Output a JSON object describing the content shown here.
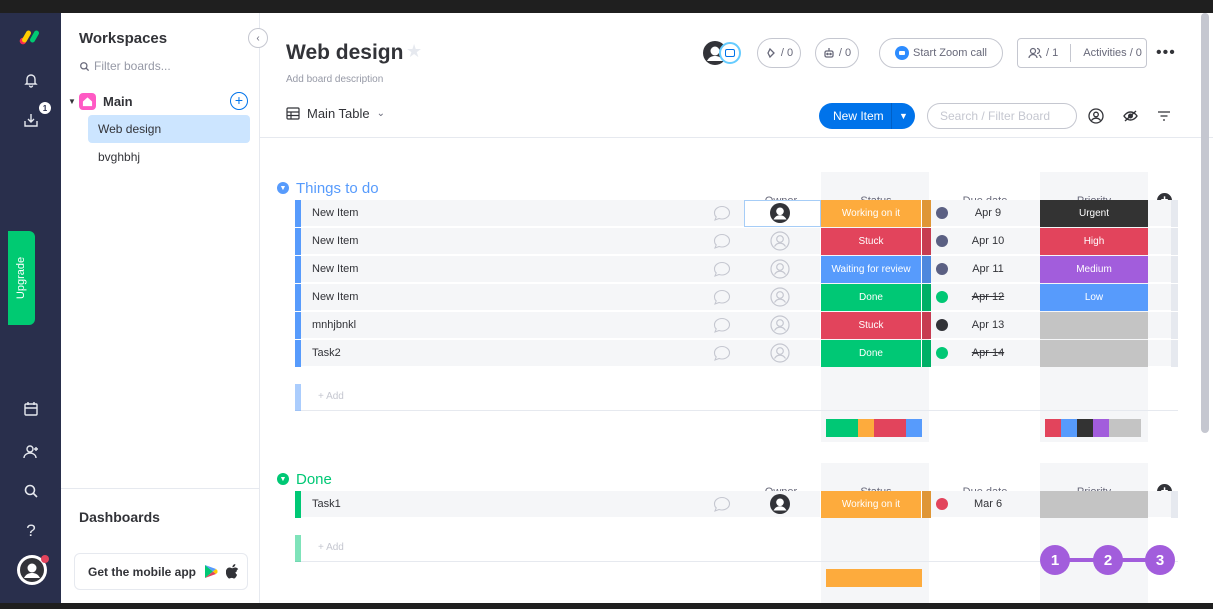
{
  "leftbar": {
    "upgrade_label": "Upgrade",
    "inbox_badge": "1",
    "icons": [
      "notifications-icon",
      "inbox-icon",
      "my-work-icon",
      "invite-icon",
      "search-icon",
      "help-icon",
      "avatar"
    ]
  },
  "sidebar": {
    "title": "Workspaces",
    "filter_placeholder": "Filter boards...",
    "workspace_name": "Main",
    "boards": [
      {
        "label": "Web design",
        "active": true
      },
      {
        "label": "bvghbhj",
        "active": false
      }
    ],
    "dashboards_label": "Dashboards",
    "mobile_app_label": "Get the mobile app"
  },
  "header": {
    "board_title": "Web design",
    "board_description": "Add board description",
    "integrations_count": "/ 0",
    "automations_count": "/ 0",
    "zoom_label": "Start Zoom call",
    "members_count": "/ 1",
    "activities_label": "Activities / 0",
    "view_label": "Main Table",
    "new_item_label": "New Item",
    "search_placeholder": "Search / Filter Board"
  },
  "columns": {
    "owner": "Owner",
    "status": "Status",
    "due_date": "Due date",
    "priority": "Priority"
  },
  "groups": [
    {
      "title": "Things to do",
      "color": "#579bfc",
      "add_label": "+ Add",
      "rows": [
        {
          "name": "New Item",
          "owner_assigned": true,
          "status": "Working on it",
          "status_color": "#fdab3d",
          "due": "Apr 9",
          "due_icon_color": "#5b6083",
          "due_done": false,
          "priority": "Urgent",
          "priority_color": "#333333"
        },
        {
          "name": "New Item",
          "owner_assigned": false,
          "status": "Stuck",
          "status_color": "#e2445c",
          "due": "Apr 10",
          "due_icon_color": "#5b6083",
          "due_done": false,
          "priority": "High",
          "priority_color": "#e2445c"
        },
        {
          "name": "New Item",
          "owner_assigned": false,
          "status": "Waiting for review",
          "status_color": "#579bfc",
          "due": "Apr 11",
          "due_icon_color": "#5b6083",
          "due_done": false,
          "priority": "Medium",
          "priority_color": "#a25ddc"
        },
        {
          "name": "New Item",
          "owner_assigned": false,
          "status": "Done",
          "status_color": "#00c875",
          "due": "Apr 12",
          "due_icon_color": "#00c875",
          "due_done": true,
          "priority": "Low",
          "priority_color": "#579bfc"
        },
        {
          "name": "mnhjbnkl",
          "owner_assigned": false,
          "status": "Stuck",
          "status_color": "#e2445c",
          "due": "Apr 13",
          "due_icon_color": "#323338",
          "due_done": false,
          "priority": "",
          "priority_color": "#c4c4c4"
        },
        {
          "name": "Task2",
          "owner_assigned": false,
          "status": "Done",
          "status_color": "#00c875",
          "due": "Apr 14",
          "due_icon_color": "#00c875",
          "due_done": true,
          "priority": "",
          "priority_color": "#c4c4c4"
        }
      ]
    },
    {
      "title": "Done",
      "color": "#00c875",
      "add_label": "+ Add",
      "rows": [
        {
          "name": "Task1",
          "owner_assigned": true,
          "status": "Working on it",
          "status_color": "#fdab3d",
          "due": "Mar 6",
          "due_icon_color": "#e2445c",
          "due_done": false,
          "priority": "",
          "priority_color": "#c4c4c4"
        }
      ]
    }
  ],
  "steps": [
    "1",
    "2",
    "3"
  ]
}
